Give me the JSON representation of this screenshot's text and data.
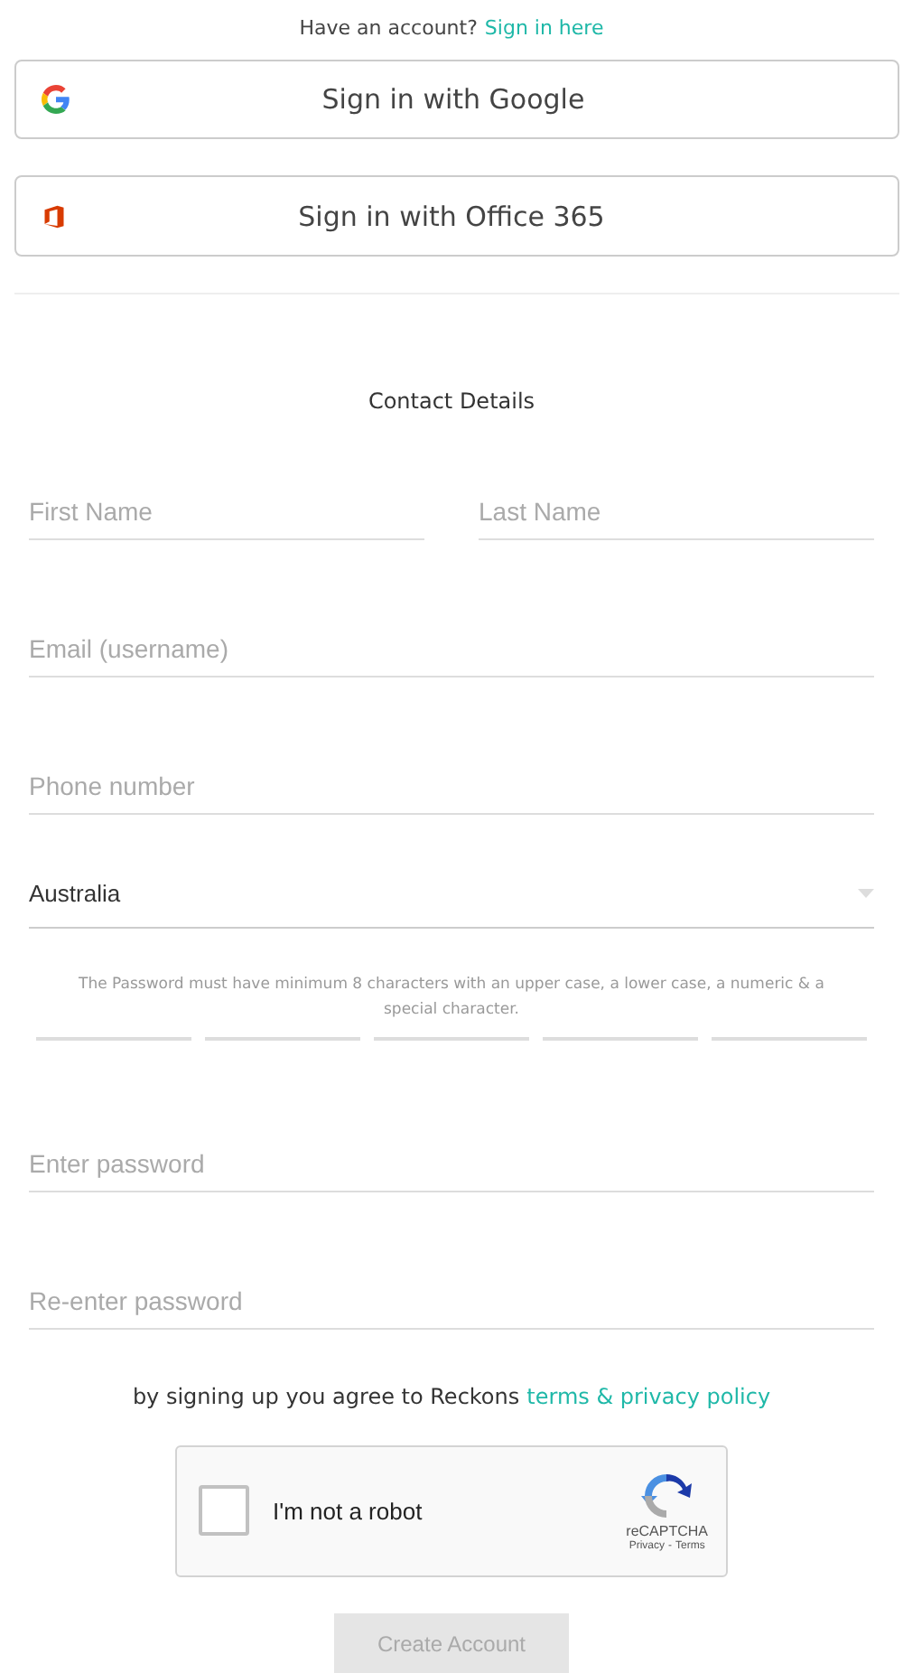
{
  "header": {
    "text": "Have an account?",
    "link": "Sign in here"
  },
  "sso_buttons": [
    {
      "kind": "google",
      "label": "Sign in with Google"
    },
    {
      "kind": "office",
      "label": "Sign in with Office 365"
    }
  ],
  "section_title": "Contact Details",
  "name_fields": [
    {
      "placeholder": "First Name"
    },
    {
      "placeholder": "Last Name"
    }
  ],
  "fields": [
    {
      "placeholder": "Email (username)"
    },
    {
      "placeholder": "Phone number"
    }
  ],
  "country": {
    "value": "Australia"
  },
  "password_hint": "The Password must have minimum 8 characters with an upper case, a lower case, a numeric & a special character.",
  "password_fields": [
    {
      "placeholder": "Enter password"
    },
    {
      "placeholder": "Re-enter password"
    }
  ],
  "terms": {
    "text": "by signing up you agree to Reckons",
    "link": "terms & privacy policy"
  },
  "captcha": {
    "label": "I'm not a robot",
    "checked": false,
    "brand": "reCAPTCHA",
    "privacy": "Privacy",
    "separator": "-",
    "terms": "Terms"
  },
  "submit": {
    "label": "Create Account",
    "disabled": true
  }
}
